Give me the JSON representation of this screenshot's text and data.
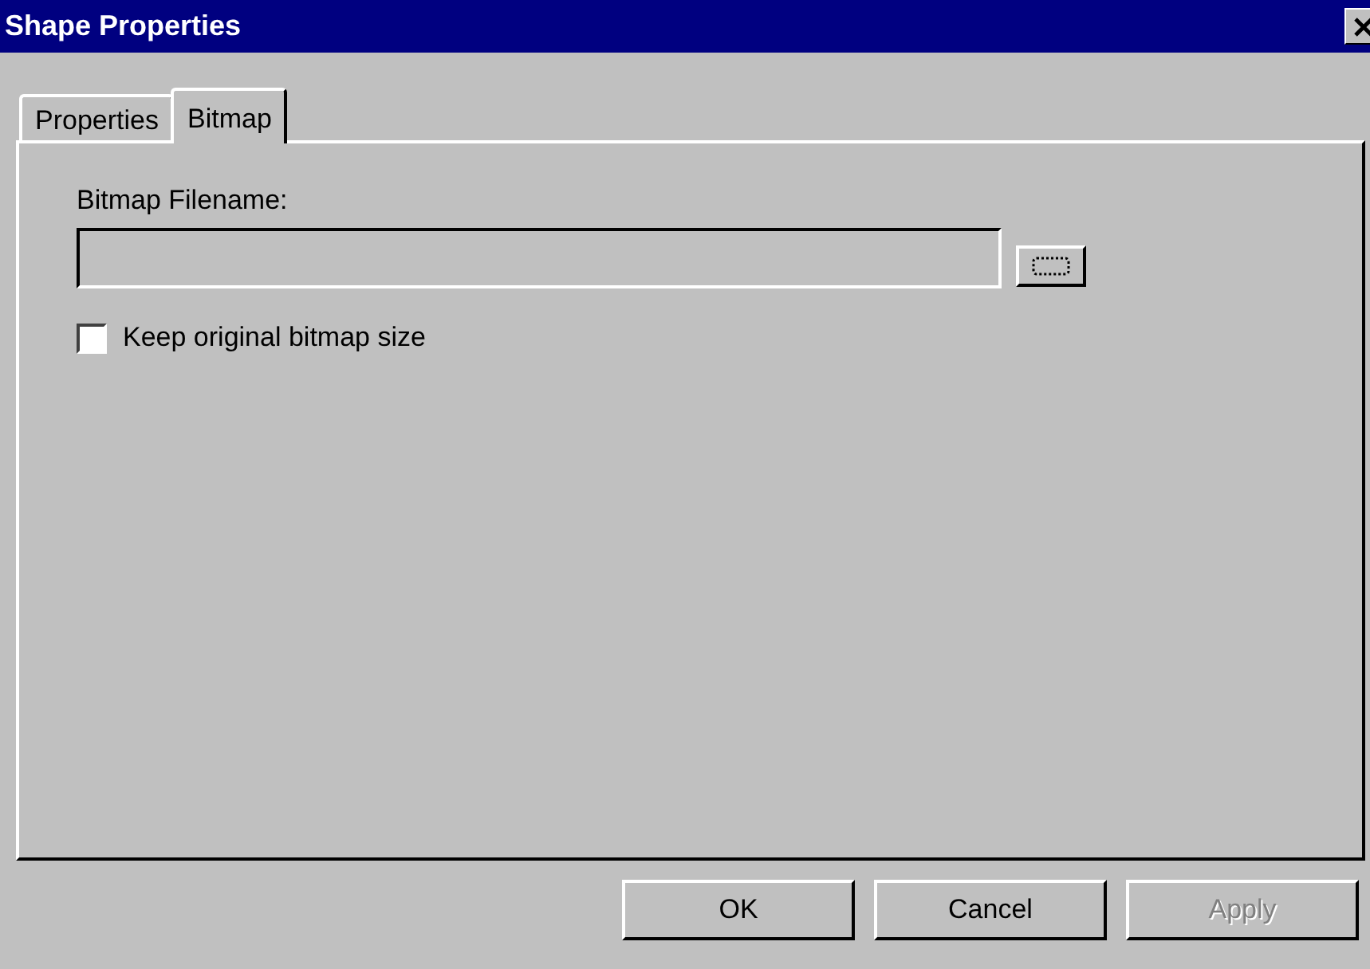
{
  "window": {
    "title": "Shape Properties"
  },
  "tabs": [
    {
      "label": "Properties",
      "selected": false
    },
    {
      "label": "Bitmap",
      "selected": true
    }
  ],
  "filename": {
    "label": "Bitmap Filename:"
  },
  "keep_size": {
    "label": "Keep original bitmap size",
    "checked": false
  },
  "buttons": [
    {
      "label": "OK",
      "disabled": false
    },
    {
      "label": "Cancel",
      "disabled": false
    },
    {
      "label": "Apply",
      "disabled": true
    }
  ]
}
